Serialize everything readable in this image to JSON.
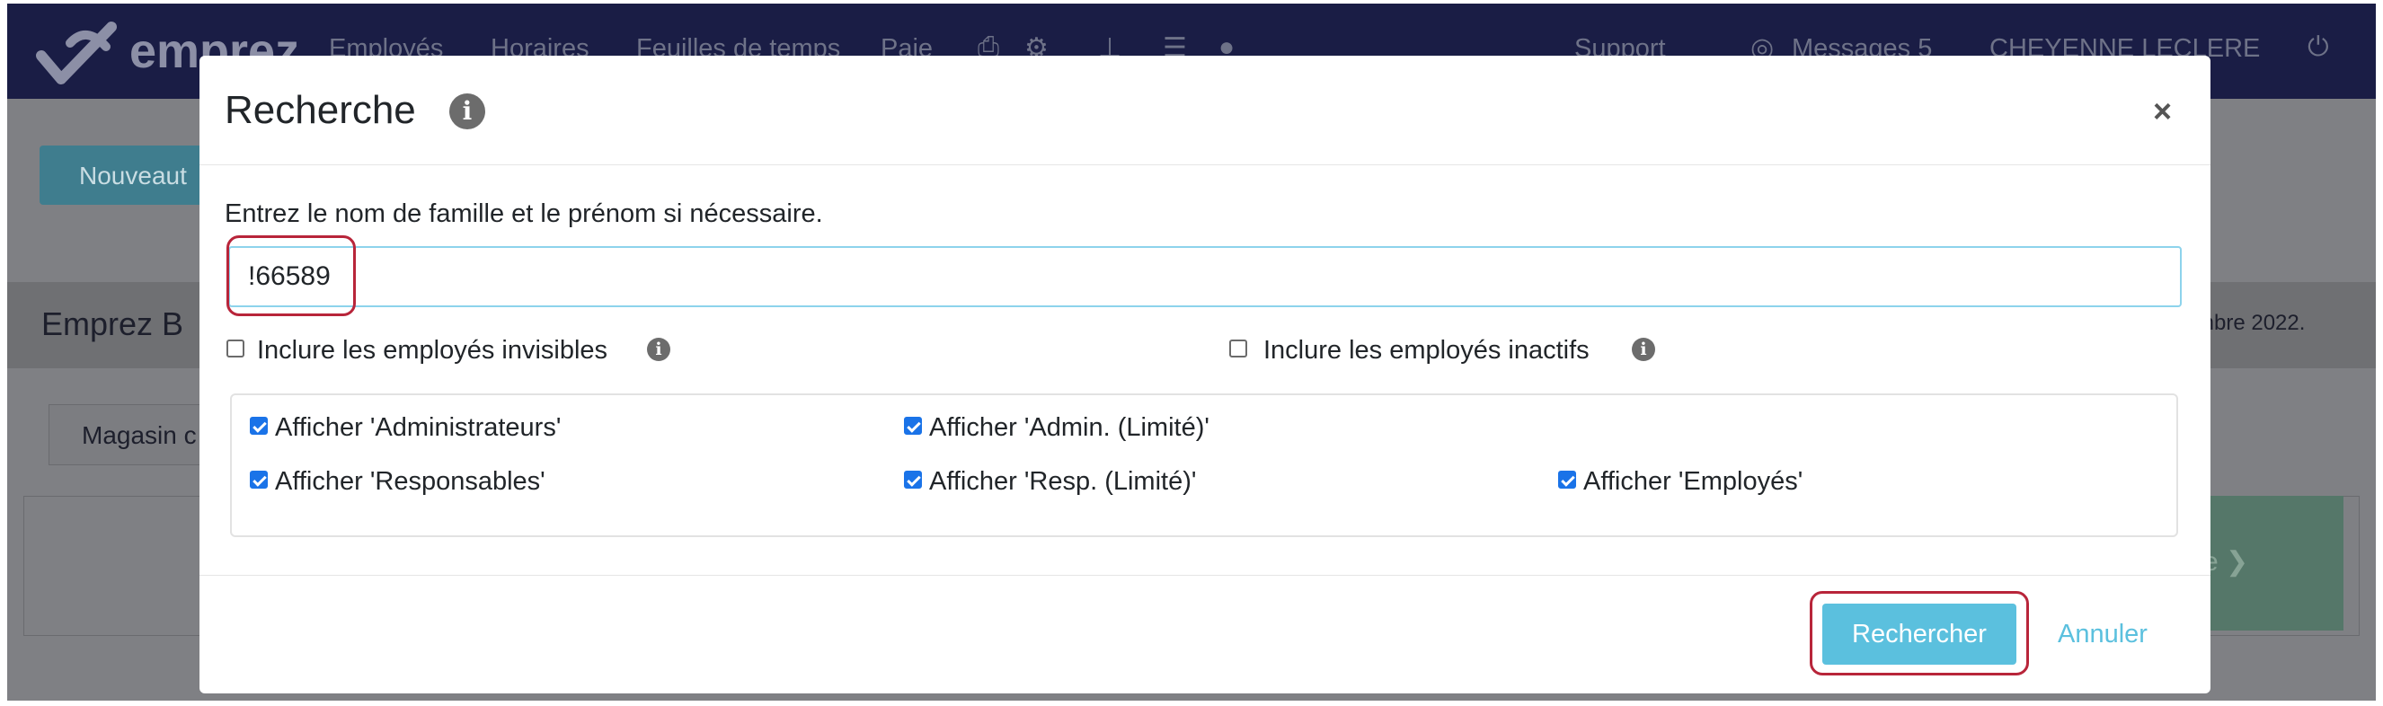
{
  "app": {
    "brand": "emprez",
    "nav": [
      "Employés",
      "Horaires",
      "Feuilles de temps",
      "Paie"
    ],
    "nav_icons": [
      "printer-icon",
      "gears-icon",
      "org-chart-icon",
      "server-icon",
      "chat-icon"
    ],
    "support": "Support",
    "messages": "Messages 5",
    "user": "CHEYENNE LECLERE",
    "power_icon": "power-icon"
  },
  "background": {
    "new_button": "Nouveaut",
    "band_title": "Emprez B",
    "band_date": "mbre 2022.",
    "store_tab": "Magasin c",
    "green_arrow": "e ❯"
  },
  "modal": {
    "title": "Recherche",
    "title_info_icon": "info-icon",
    "close": "×",
    "instruction": "Entrez le nom de famille et le prénom si nécessaire.",
    "search_value": "!66589",
    "options": {
      "invisible": {
        "label": "Inclure les employés invisibles",
        "checked": false
      },
      "inactive": {
        "label": "Inclure les employés inactifs",
        "checked": false
      }
    },
    "roles": [
      {
        "label": "Afficher 'Administrateurs'",
        "checked": true
      },
      {
        "label": "Afficher 'Admin. (Limité)'",
        "checked": true
      },
      {
        "label": "Afficher 'Responsables'",
        "checked": true
      },
      {
        "label": "Afficher 'Resp. (Limité)'",
        "checked": true
      },
      {
        "label": "Afficher 'Employés'",
        "checked": true
      }
    ],
    "search_button": "Rechercher",
    "cancel": "Annuler"
  },
  "colors": {
    "nav_bg": "#1a1d45",
    "accent": "#5bc0de",
    "highlight": "#b8253a",
    "checkbox": "#1a73e8"
  }
}
